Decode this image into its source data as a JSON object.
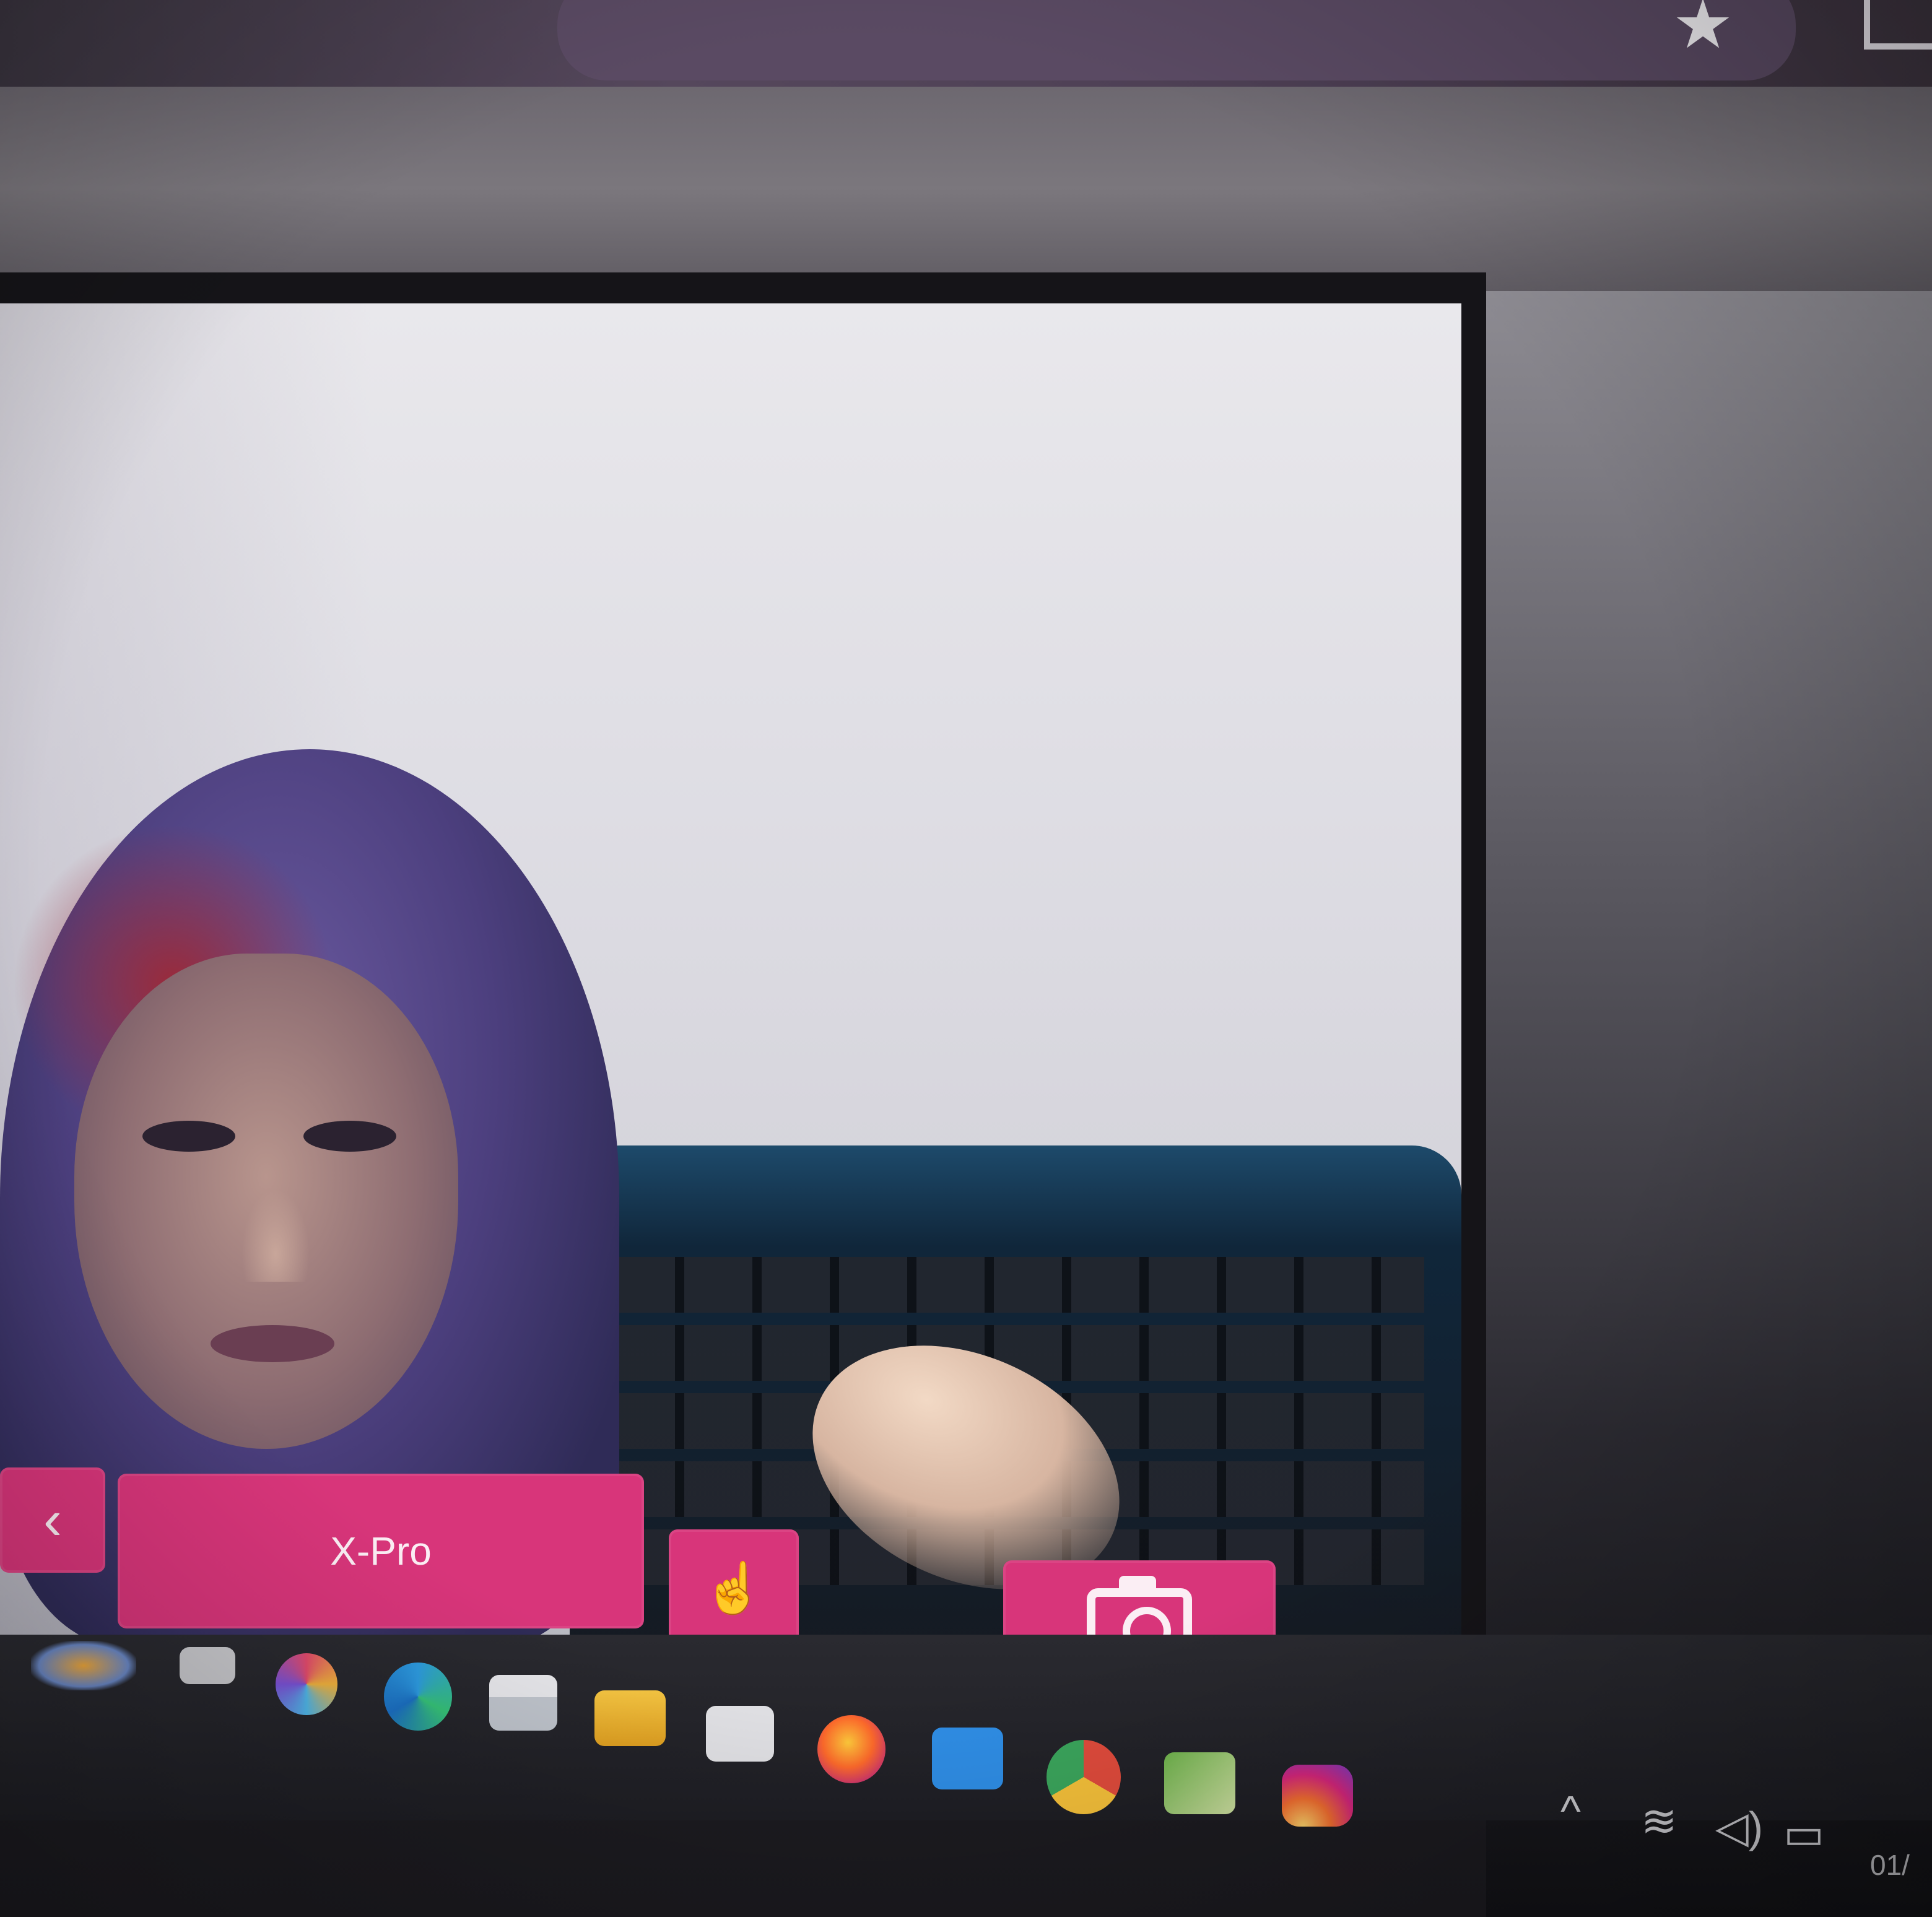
{
  "browser": {
    "bookmark_icon": "star-icon",
    "extensions_icon": "puzzle-icon"
  },
  "video_controls": {
    "prev_icon": "chevron-left-icon",
    "prev_glyph": "‹",
    "record_label": "X-Pro",
    "gesture_icon": "hand-pointer-icon",
    "gesture_glyph": "☝",
    "capture_icon": "camera-icon"
  },
  "taskbar": {
    "apps": [
      "weather-widget",
      "search-icon",
      "copilot-icon",
      "edge-icon",
      "explorer-app-icon",
      "files-icon",
      "store-icon",
      "firefox-icon",
      "app-blue-icon",
      "chrome-icon",
      "sheet-icon",
      "instagram-icon"
    ],
    "tray": {
      "overflow_glyph": "^",
      "wifi_glyph": "≋",
      "volume_glyph": "◁)",
      "battery_glyph": "▭",
      "clock": "01/"
    }
  },
  "colors": {
    "accent_pink": "#d8357a",
    "taskbar": "#1e1e24"
  }
}
